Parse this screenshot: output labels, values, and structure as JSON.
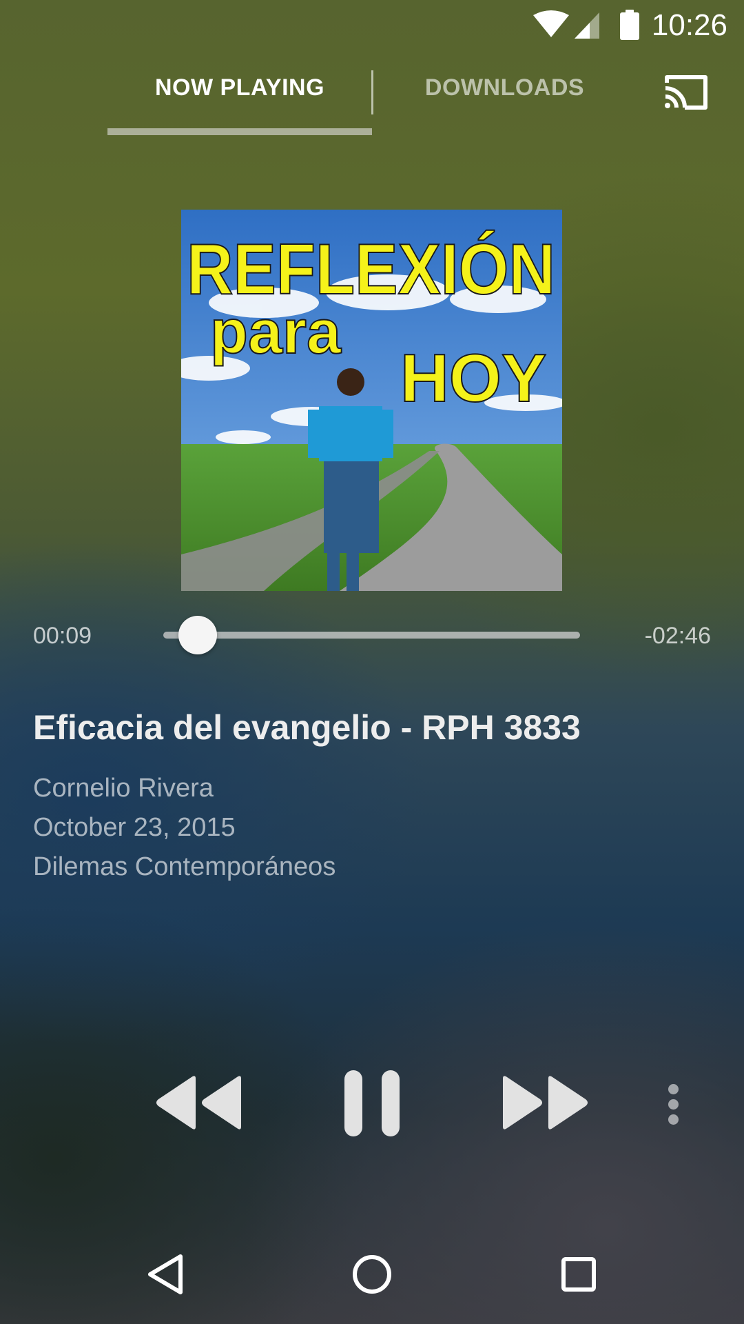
{
  "status_bar": {
    "time": "10:26",
    "icons": [
      "wifi-icon",
      "cellular-signal-icon",
      "battery-icon"
    ]
  },
  "tabs": [
    {
      "label": "NOW PLAYING",
      "selected": true
    },
    {
      "label": "DOWNLOADS",
      "selected": false
    }
  ],
  "toolbar": {
    "cast_icon": "cast-icon"
  },
  "album_art": {
    "line1": "REFLEXIÓN",
    "line2": "para",
    "line3": "HOY"
  },
  "player": {
    "elapsed": "00:09",
    "remaining": "-02:46",
    "progress_fraction": 0.05
  },
  "episode": {
    "title": "Eficacia del evangelio - RPH 3833",
    "author": "Cornelio Rivera",
    "date": "October 23, 2015",
    "series": "Dilemas Contemporáneos"
  },
  "controls": [
    "rewind-icon",
    "pause-icon",
    "fast-forward-icon",
    "more-vert-icon"
  ],
  "nav_bar": [
    "back-icon",
    "home-icon",
    "recents-icon"
  ],
  "colors": {
    "art_title_yellow": "#f5f21a",
    "sky_blue": "#2f76c8",
    "shirt_blue": "#1e9ad8"
  }
}
